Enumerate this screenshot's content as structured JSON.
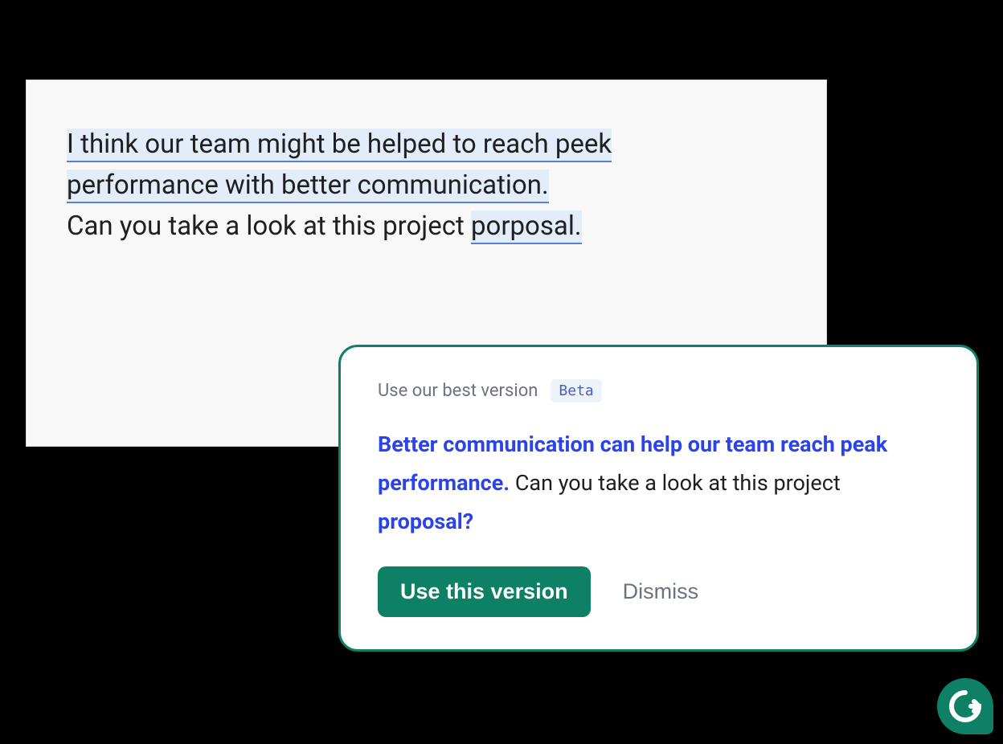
{
  "editor": {
    "highlighted_line_1": "I think our team might be helped to reach peek",
    "highlighted_line_2": "performance with better communication.",
    "plain_prefix": "Can you take a look at this project ",
    "highlighted_word": "porposal."
  },
  "suggestion": {
    "header_title": "Use our best version",
    "beta_label": "Beta",
    "bold_part_1": "Better communication can help our team reach peak performance.",
    "plain_middle": " Can you take a look at this project ",
    "bold_part_2": "proposal?",
    "use_button_label": "Use this version",
    "dismiss_label": "Dismiss"
  },
  "colors": {
    "brand_green": "#0d8065",
    "suggestion_blue": "#2b44e7",
    "highlight_bg": "#e3ecf9",
    "underline": "#5b7fd9"
  }
}
